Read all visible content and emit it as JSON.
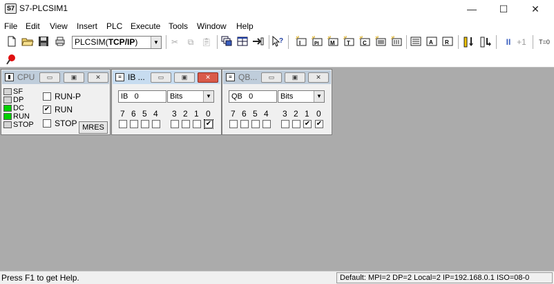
{
  "window": {
    "title": "S7-PLCSIM1",
    "minimize": "—",
    "maximize": "☐",
    "close": "✕",
    "icon_text": "S7"
  },
  "menu": [
    "File",
    "Edit",
    "View",
    "Insert",
    "PLC",
    "Execute",
    "Tools",
    "Window",
    "Help"
  ],
  "toolbar": {
    "connection_prefix": "PLCSIM(",
    "connection_bold": "TCP/IP",
    "connection_suffix": ")",
    "cycle_buttons": [
      "II",
      "+1"
    ],
    "timer_label": "T=0"
  },
  "cpu_window": {
    "title": "CPU",
    "leds": [
      {
        "label": "SF",
        "color": "#d4d4d4"
      },
      {
        "label": "DP",
        "color": "#d4d4d4"
      },
      {
        "label": "DC",
        "color": "#00d000"
      },
      {
        "label": "RUN",
        "color": "#00d000"
      },
      {
        "label": "STOP",
        "color": "#d4d4d4"
      }
    ],
    "modes": [
      {
        "label": "RUN-P",
        "checked": false
      },
      {
        "label": "RUN",
        "checked": true
      },
      {
        "label": "STOP",
        "checked": false
      }
    ],
    "mres_label": "MRES"
  },
  "ib_window": {
    "title": "IB ...",
    "area": "IB",
    "address": "0",
    "format": "Bits",
    "bits": [
      {
        "n": "7",
        "checked": false
      },
      {
        "n": "6",
        "checked": false
      },
      {
        "n": "5",
        "checked": false
      },
      {
        "n": "4",
        "checked": false
      },
      {
        "n": "3",
        "checked": false
      },
      {
        "n": "2",
        "checked": false
      },
      {
        "n": "1",
        "checked": false
      },
      {
        "n": "0",
        "checked": true
      }
    ]
  },
  "qb_window": {
    "title": "QB...",
    "area": "QB",
    "address": "0",
    "format": "Bits",
    "bits": [
      {
        "n": "7",
        "checked": false
      },
      {
        "n": "6",
        "checked": false
      },
      {
        "n": "5",
        "checked": false
      },
      {
        "n": "4",
        "checked": false
      },
      {
        "n": "3",
        "checked": false
      },
      {
        "n": "2",
        "checked": false
      },
      {
        "n": "1",
        "checked": true
      },
      {
        "n": "0",
        "checked": true
      }
    ]
  },
  "statusbar": {
    "help": "Press F1 to get Help.",
    "info": "Default:  MPI=2 DP=2 Local=2 IP=192.168.0.1 ISO=08-0"
  },
  "colors": {
    "mdi_background": "#ababab",
    "led_green": "#00d000",
    "active_title": "#c7dcf0"
  }
}
